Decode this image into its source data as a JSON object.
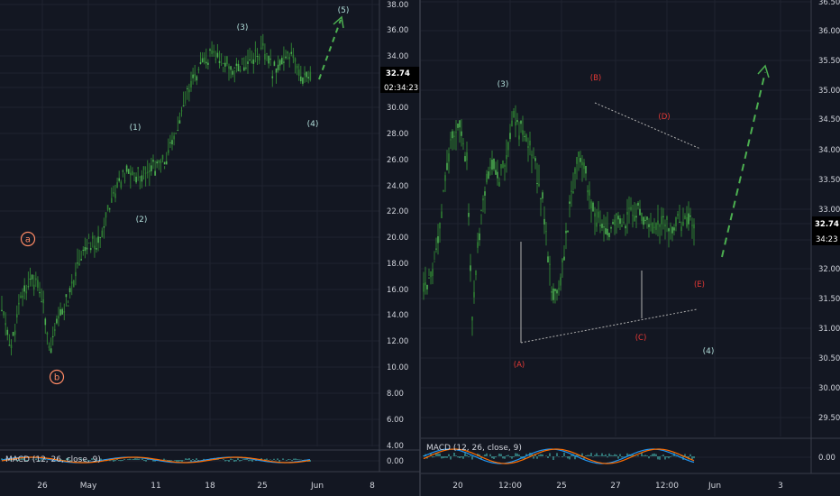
{
  "theme": {
    "background": "#131722",
    "grid": "#1f2330",
    "divider": "#3a3e4a",
    "axis_text": "#d1d4dc",
    "candle": "#2e7d32",
    "candle_bright": "#4caf50",
    "wave_primary": "#b2dfdb",
    "wave_dash": "#4caf50",
    "wave_corrective": "#e53935",
    "wave_circle": "#ff8a65",
    "macd_line": "#2196f3",
    "macd_signal": "#ff6d00",
    "macd_hist": "#4dd0c8",
    "price_tag_text": "#ffffff",
    "triangle_line": "#b0b0b0"
  },
  "chart_data": [
    {
      "type": "line",
      "series": [
        {
          "x": [
            0,
            3,
            6,
            9,
            12,
            15,
            18,
            21,
            24,
            27,
            30,
            33,
            36,
            39,
            42,
            45,
            48,
            51,
            54,
            57,
            60,
            63,
            66,
            69,
            72,
            75,
            78,
            81,
            84,
            87,
            90,
            93,
            96
          ],
          "values": [
            14.5,
            11.5,
            15.5,
            17.0,
            16.0,
            11.5,
            14.0,
            15.5,
            18.5,
            19.5,
            19.5,
            22.5,
            24.0,
            25.0,
            24.8,
            25.2,
            25.5,
            26.0,
            28.0,
            30.5,
            32.5,
            33.5,
            34.2,
            33.5,
            33.0,
            33.5,
            34.0,
            34.5,
            33.0,
            33.5,
            34.0,
            32.5,
            32.7
          ]
        }
      ],
      "x_tick_labels": [
        "26",
        "May",
        "11",
        "18",
        "25",
        "Jun",
        "8"
      ],
      "y_tick_labels": [
        "38.00",
        "36.00",
        "34.00",
        "32.74",
        "02:34:23",
        "30.00",
        "28.00",
        "26.00",
        "24.00",
        "22.00",
        "20.00",
        "18.00",
        "16.00",
        "14.00",
        "12.00",
        "10.00",
        "8.00",
        "6.00",
        "4.00",
        "0.00"
      ],
      "ylim": [
        4.0,
        38.0
      ],
      "price_tag": {
        "price": "32.74",
        "countdown": "02:34:23"
      },
      "wave_labels": [
        "(1)",
        "(2)",
        "(3)",
        "(4)",
        "(5)"
      ],
      "circle_labels": [
        "a",
        "b"
      ],
      "indicator": "MACD (12, 26, close, 9)",
      "indicator_axis_label": "0.00"
    },
    {
      "type": "line",
      "series": [
        {
          "x": [
            0,
            4,
            8,
            12,
            16,
            20,
            24,
            27,
            30,
            34,
            38,
            42,
            46,
            50,
            54,
            58,
            62,
            66,
            70,
            74,
            78,
            82,
            86,
            88,
            91,
            94,
            98,
            102,
            106,
            110,
            114,
            118,
            122,
            126,
            130,
            134,
            138,
            142,
            146,
            150
          ],
          "values": [
            31.7,
            31.8,
            32.5,
            33.5,
            34.2,
            34.3,
            33.8,
            31.2,
            32.4,
            33.3,
            33.7,
            33.6,
            33.9,
            34.5,
            34.3,
            34.1,
            33.8,
            33.1,
            31.9,
            31.5,
            32.3,
            33.2,
            33.9,
            33.8,
            33.4,
            33.0,
            32.8,
            32.6,
            32.8,
            32.7,
            32.9,
            33.0,
            32.9,
            32.7,
            32.8,
            32.8,
            32.7,
            32.8,
            32.8,
            32.74
          ]
        }
      ],
      "x_tick_labels": [
        "20",
        "12:00",
        "25",
        "27",
        "12:00",
        "Jun",
        "3"
      ],
      "y_tick_labels": [
        "36.50",
        "36.00",
        "35.50",
        "35.00",
        "34.50",
        "34.00",
        "33.50",
        "33.00",
        "32.74",
        "34:23",
        "32.00",
        "31.50",
        "31.00",
        "30.50",
        "30.00",
        "29.50",
        "0.00"
      ],
      "ylim": [
        29.5,
        36.5
      ],
      "price_tag": {
        "price": "32.74",
        "countdown": "34:23"
      },
      "wave_labels": [
        "(3)",
        "(4)"
      ],
      "corrective_labels": [
        "(A)",
        "(B)",
        "(C)",
        "(D)",
        "(E)"
      ],
      "indicator": "MACD (12, 26, close, 9)",
      "indicator_axis_label": "0.00"
    }
  ]
}
